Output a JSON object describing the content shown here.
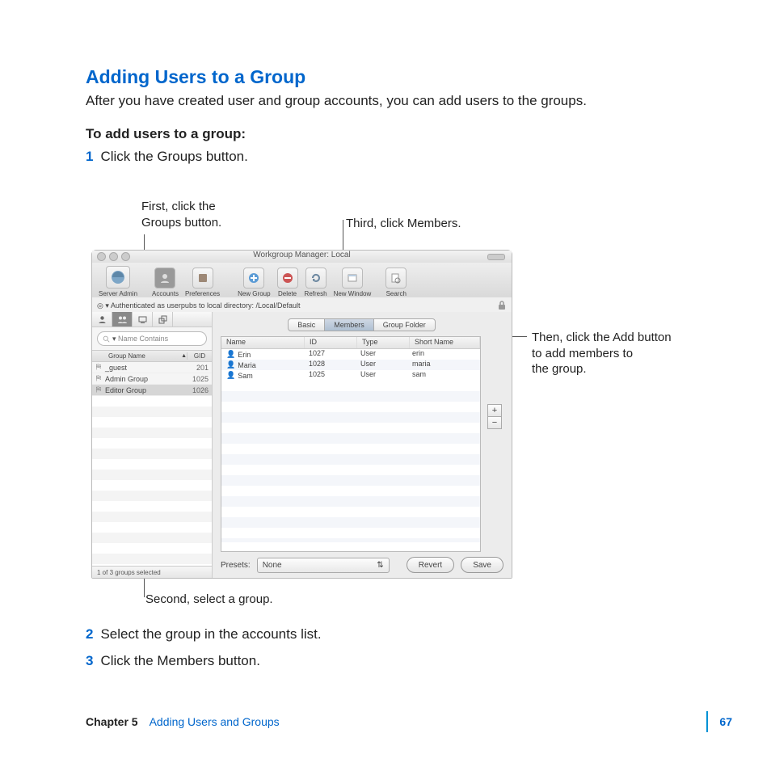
{
  "heading": "Adding Users to a Group",
  "intro": "After you have created user and group accounts, you can add users to the groups.",
  "subhead": "To add users to a group:",
  "steps": {
    "s1": "Click the Groups button.",
    "s2": "Select the group in the accounts list.",
    "s3": "Click the Members button."
  },
  "callouts": {
    "first_a": "First, click the",
    "first_b": "Groups button.",
    "third": "Third, click Members.",
    "second": "Second, select a group.",
    "then_a": "Then, click the Add button",
    "then_b": "to add members to",
    "then_c": "the group."
  },
  "win": {
    "title": "Workgroup Manager: Local",
    "toolbar": {
      "server_admin": "Server Admin",
      "accounts": "Accounts",
      "preferences": "Preferences",
      "new_group": "New Group",
      "delete": "Delete",
      "refresh": "Refresh",
      "new_window": "New Window",
      "search": "Search"
    },
    "auth": "Authenticated as userpubs to local directory: /Local/Default",
    "search_placeholder": "Name Contains",
    "group_header": {
      "name": "Group Name",
      "gid": "GID"
    },
    "groups": [
      {
        "name": "_guest",
        "gid": "201"
      },
      {
        "name": "Admin Group",
        "gid": "1025"
      },
      {
        "name": "Editor Group",
        "gid": "1026"
      }
    ],
    "status": "1 of 3 groups selected",
    "tabs": {
      "basic": "Basic",
      "members": "Members",
      "group_folder": "Group Folder"
    },
    "members_header": {
      "name": "Name",
      "id": "ID",
      "type": "Type",
      "short": "Short Name"
    },
    "members": [
      {
        "name": "Erin",
        "id": "1027",
        "type": "User",
        "short": "erin"
      },
      {
        "name": "Maria",
        "id": "1028",
        "type": "User",
        "short": "maria"
      },
      {
        "name": "Sam",
        "id": "1025",
        "type": "User",
        "short": "sam"
      }
    ],
    "presets_label": "Presets:",
    "presets_value": "None",
    "revert": "Revert",
    "save": "Save",
    "add": "+",
    "remove": "−"
  },
  "footer": {
    "chapter": "Chapter 5",
    "title": "Adding Users and Groups",
    "page": "67"
  }
}
